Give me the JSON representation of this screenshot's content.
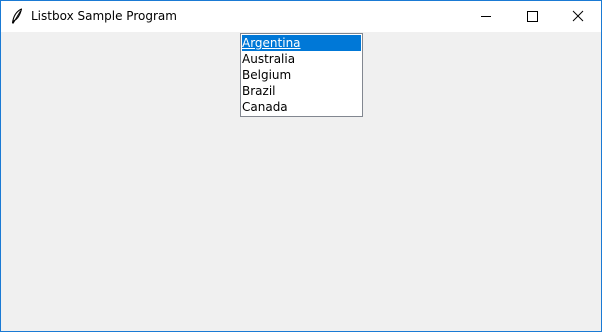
{
  "window": {
    "title": "Listbox Sample Program",
    "app_icon": "feather-icon",
    "controls": {
      "minimize_icon": "minimize-icon",
      "maximize_icon": "maximize-icon",
      "close_icon": "close-icon"
    }
  },
  "listbox": {
    "selected_index": 0,
    "items": [
      {
        "label": "Argentina"
      },
      {
        "label": "Australia"
      },
      {
        "label": "Belgium"
      },
      {
        "label": "Brazil"
      },
      {
        "label": "Canada"
      }
    ]
  },
  "colors": {
    "selection": "#0078d7",
    "window_border": "#1a7ad4",
    "client_background": "#f0f0f0",
    "listbox_border": "#828790"
  }
}
